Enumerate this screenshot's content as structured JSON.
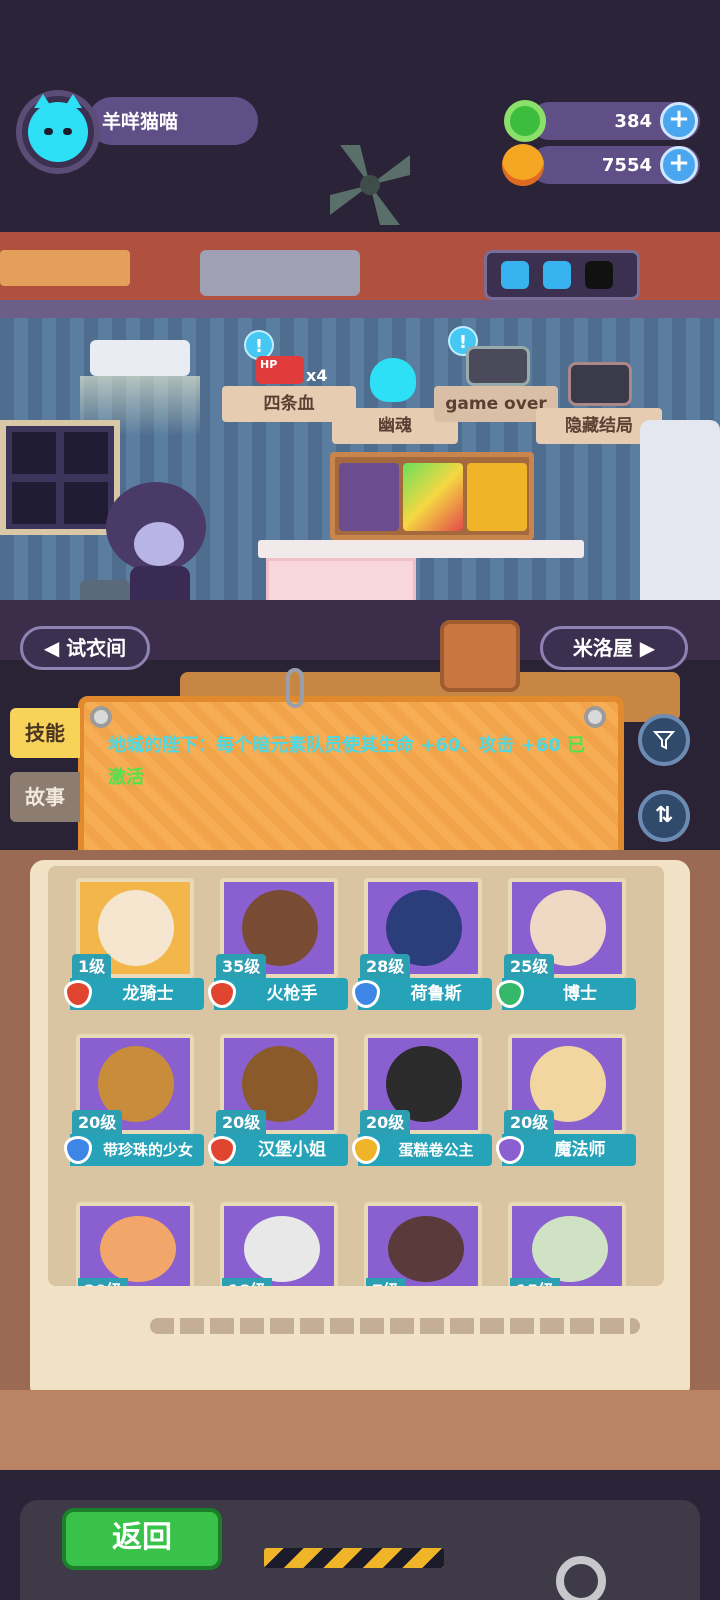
{
  "player": {
    "name": "羊咩猫喵",
    "avatar_icon": "cat-avatar-icon"
  },
  "currencies": [
    {
      "icon": "donut-coin-icon",
      "value": "384",
      "color": "#3dbd3d"
    },
    {
      "icon": "planet-gem-icon",
      "value": "7554",
      "color": "#f5a623"
    }
  ],
  "battery": {
    "charged_cells": 2,
    "total_cells": 3
  },
  "room": {
    "banners": [
      {
        "label": "四条血",
        "badge": "x4",
        "item_icon": "hp-battery-icon"
      },
      {
        "label": "幽魂",
        "item_icon": "skull-ghost-icon"
      },
      {
        "label": "隐藏结局",
        "item_icon": "tv-icon"
      }
    ],
    "gameover_label": "game over",
    "nav_left": "试衣间",
    "nav_right": "米洛屋"
  },
  "tabs": {
    "skill": "技能",
    "story": "故事"
  },
  "skill_board": {
    "text": "地城的陛下：每个暗元素队员使其生命 +60、攻击 +60",
    "status": "已激活"
  },
  "heroes": [
    {
      "level": "1级",
      "name": "龙骑士",
      "shield_color": "#e0462f",
      "bg": "#f2b64a"
    },
    {
      "level": "35级",
      "name": "火枪手",
      "shield_color": "#e0462f",
      "bg": "#8a5fd0"
    },
    {
      "level": "28级",
      "name": "荷鲁斯",
      "shield_color": "#3e86e6",
      "bg": "#8a5fd0"
    },
    {
      "level": "25级",
      "name": "博士",
      "shield_color": "#36b86a",
      "bg": "#8a5fd0"
    },
    {
      "level": "20级",
      "name": "带珍珠的少女",
      "shield_color": "#3e86e6",
      "bg": "#8a5fd0"
    },
    {
      "level": "20级",
      "name": "汉堡小姐",
      "shield_color": "#e0462f",
      "bg": "#8a5fd0"
    },
    {
      "level": "20级",
      "name": "蛋糕卷公主",
      "shield_color": "#f0b429",
      "bg": "#8a5fd0"
    },
    {
      "level": "20级",
      "name": "魔法师",
      "shield_color": "#8a5fd0",
      "bg": "#8a5fd0"
    }
  ],
  "partial_row_levels": [
    "20级",
    "18级",
    "7级",
    "15级"
  ],
  "footer": {
    "back_label": "返回"
  }
}
